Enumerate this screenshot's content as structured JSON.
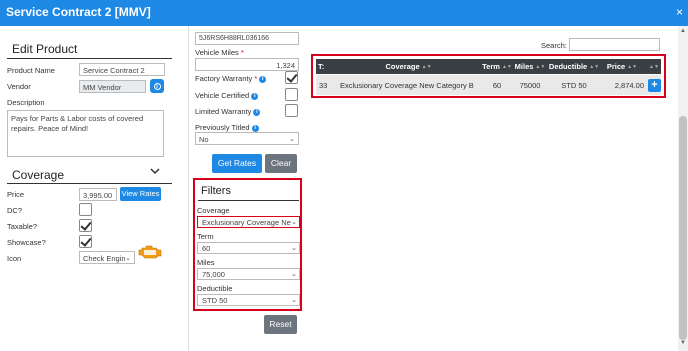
{
  "window": {
    "title": "Service Contract 2 [MMV]",
    "close_glyph": "×"
  },
  "edit_product": {
    "heading": "Edit Product",
    "product_name_label": "Product Name",
    "product_name_value": "Service Contract 2",
    "vendor_label": "Vendor",
    "vendor_value": "MM Vendor",
    "description_label": "Description",
    "description_value": "Pays for Parts & Labor costs of covered repairs. Peace of Mind!"
  },
  "coverage": {
    "heading": "Coverage",
    "price_label": "Price",
    "price_value": "3,995.00",
    "view_rates_label": "View Rates",
    "dc_label": "DC?",
    "taxable_label": "Taxable?",
    "showcase_label": "Showcase?",
    "icon_label": "Icon",
    "icon_value": "Check Engin",
    "dc_checked": false,
    "taxable_checked": true,
    "showcase_checked": true
  },
  "vehicle": {
    "vin_value": "5J6RS6H88RL036166",
    "miles_label": "Vehicle Miles",
    "miles_required": "*",
    "miles_value": "1,324",
    "factory_warranty_label": "Factory Warranty",
    "factory_warranty_required": "*",
    "factory_warranty_checked": true,
    "vehicle_certified_label": "Vehicle Certified",
    "limited_warranty_label": "Limited Warranty",
    "previously_titled_label": "Previously Titled",
    "previously_titled_value": "No",
    "info_glyph": "i"
  },
  "actions": {
    "get_rates_label": "Get Rates",
    "clear_label": "Clear",
    "reset_label": "Reset"
  },
  "filters": {
    "heading": "Filters",
    "coverage_label": "Coverage",
    "coverage_value": "Exclusionary Coverage New",
    "term_label": "Term",
    "term_value": "60",
    "miles_label": "Miles",
    "miles_value": "75,000",
    "deductible_label": "Deductible",
    "deductible_value": "STD 50"
  },
  "rates_table": {
    "search_label": "Search:",
    "columns": [
      "T:",
      "Coverage",
      "Term",
      "Miles",
      "Deductible",
      "Price"
    ],
    "rows": [
      {
        "t": "33",
        "coverage": "Exclusionary Coverage New Category B",
        "term": "60",
        "miles": "75000",
        "deductible": "STD 50",
        "price": "2,874.00"
      }
    ],
    "add_glyph": "+"
  },
  "colors": {
    "primary": "#1e88e5",
    "highlight": "#d9001b",
    "secondary": "#6c757d",
    "table_header": "#3a3f44"
  }
}
